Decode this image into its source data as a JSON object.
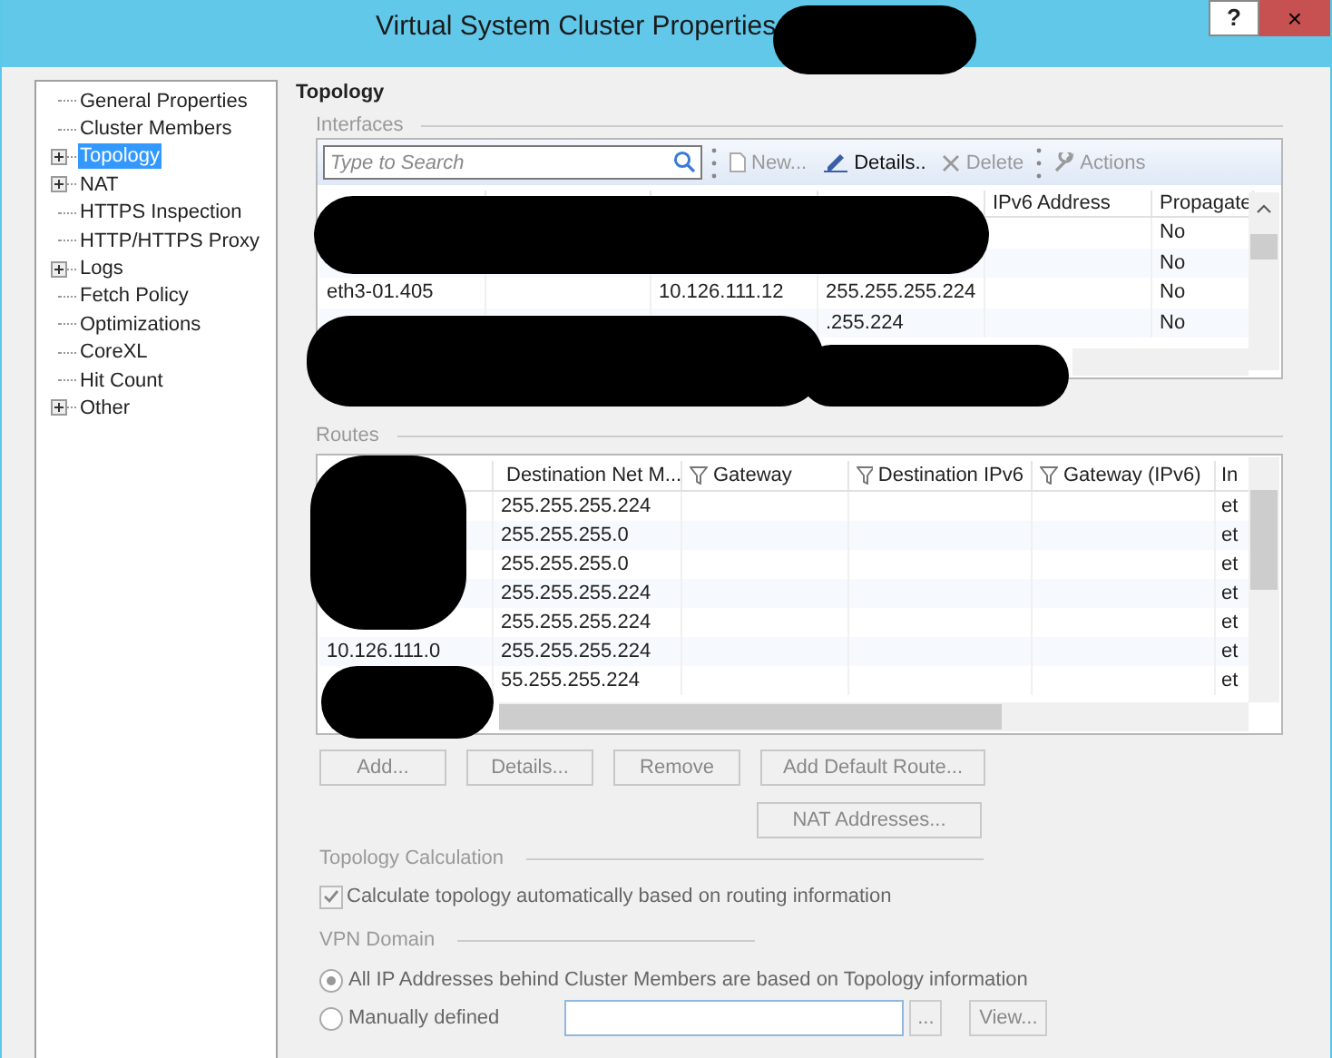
{
  "window": {
    "title": "Virtual System Cluster Properties",
    "help": "?",
    "close": "×"
  },
  "sidebar": {
    "items": [
      {
        "label": "General Properties",
        "expandable": false,
        "selected": false
      },
      {
        "label": "Cluster Members",
        "expandable": false,
        "selected": false
      },
      {
        "label": "Topology",
        "expandable": true,
        "selected": true
      },
      {
        "label": "NAT",
        "expandable": true,
        "selected": false
      },
      {
        "label": "HTTPS Inspection",
        "expandable": false,
        "selected": false
      },
      {
        "label": "HTTP/HTTPS Proxy",
        "expandable": false,
        "selected": false
      },
      {
        "label": "Logs",
        "expandable": true,
        "selected": false
      },
      {
        "label": "Fetch Policy",
        "expandable": false,
        "selected": false
      },
      {
        "label": "Optimizations",
        "expandable": false,
        "selected": false
      },
      {
        "label": "CoreXL",
        "expandable": false,
        "selected": false
      },
      {
        "label": "Hit Count",
        "expandable": false,
        "selected": false
      },
      {
        "label": "Other",
        "expandable": true,
        "selected": false
      }
    ]
  },
  "page_title": "Topology",
  "interfaces": {
    "label": "Interfaces",
    "search": {
      "placeholder": "Type to Search"
    },
    "toolbar": [
      {
        "label": "New...",
        "kind": "new",
        "disabled": true
      },
      {
        "label": "Details..",
        "kind": "details",
        "disabled": false
      },
      {
        "label": "Delete",
        "kind": "delete",
        "disabled": true
      },
      {
        "label": "Actions",
        "kind": "actions",
        "disabled": true
      }
    ],
    "columns": [
      "",
      "",
      "",
      "",
      "IPv6 Address",
      "Propagate"
    ],
    "rows": [
      [
        "",
        "",
        "",
        "",
        "",
        "No"
      ],
      [
        "",
        "",
        "",
        "",
        "",
        "No"
      ],
      [
        "eth3-01.405",
        "",
        "10.126.111.12",
        "255.255.255.224",
        "",
        "No"
      ],
      [
        "",
        "",
        "",
        ".255.224",
        "",
        "No"
      ]
    ]
  },
  "routes": {
    "label": "Routes",
    "columns": [
      "",
      "Destination Net M...",
      "Gateway",
      "Destination IPv6",
      "Gateway (IPv6)",
      "In"
    ],
    "rows": [
      [
        "",
        "255.255.255.224",
        "",
        "",
        "",
        "et"
      ],
      [
        "",
        "255.255.255.0",
        "",
        "",
        "",
        "et"
      ],
      [
        "",
        "255.255.255.0",
        "",
        "",
        "",
        "et"
      ],
      [
        "",
        "255.255.255.224",
        "",
        "",
        "",
        "et"
      ],
      [
        "",
        "255.255.255.224",
        "",
        "",
        "",
        "et"
      ],
      [
        "10.126.111.0",
        "255.255.255.224",
        "",
        "",
        "",
        "et"
      ],
      [
        "",
        "55.255.255.224",
        "",
        "",
        "",
        "et"
      ]
    ],
    "buttons": [
      "Add...",
      "Details...",
      "Remove",
      "Add Default Route..."
    ],
    "nat_button": "NAT Addresses..."
  },
  "topology_calculation": {
    "label": "Topology Calculation",
    "checkbox": {
      "label": "Calculate topology automatically based on routing information",
      "checked": true
    }
  },
  "vpn_domain": {
    "label": "VPN Domain",
    "options": [
      {
        "label": "All IP Addresses behind Cluster Members are based on Topology information",
        "selected": true
      },
      {
        "label": "Manually defined",
        "selected": false
      }
    ],
    "browse": "...",
    "view": "View..."
  }
}
